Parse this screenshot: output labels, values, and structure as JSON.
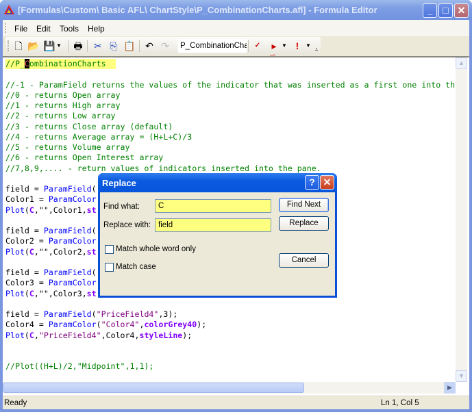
{
  "window": {
    "title": "[Formulas\\Custom\\ Basic AFL\\ ChartStyle\\P_CombinationCharts.afl] - Formula Editor"
  },
  "menu": [
    "File",
    "Edit",
    "Tools",
    "Help"
  ],
  "toolbar": {
    "formula_combo": "P_CombinationChar",
    "icons": [
      "new-file-icon",
      "open-folder-icon",
      "save-icon",
      "dropdown-arrow-icon",
      "print-icon",
      "cut-icon",
      "copy-icon",
      "paste-icon",
      "undo-icon",
      "redo-icon",
      "afl-check-icon",
      "apply-chart-icon",
      "dropdown-arrow-icon",
      "exclamation-icon",
      "dropdown-arrow-icon",
      "toolbar-options-icon"
    ]
  },
  "code": [
    [
      [
        "//P_",
        "c"
      ],
      [
        "C",
        "cur"
      ],
      [
        "ombinationCharts",
        "c"
      ]
    ],
    [],
    [
      [
        "//-1 - ParamField returns the values of the indicator that was inserted as a first one into th",
        "c"
      ]
    ],
    [
      [
        "//0 - returns Open array",
        "c"
      ]
    ],
    [
      [
        "//1 - returns High array",
        "c"
      ]
    ],
    [
      [
        "//2 - returns Low array",
        "c"
      ]
    ],
    [
      [
        "//3 - returns Close array (default)",
        "c"
      ]
    ],
    [
      [
        "//4 - returns Average array = (H+L+C)/3",
        "c"
      ]
    ],
    [
      [
        "//5 - returns Volume array",
        "c"
      ]
    ],
    [
      [
        "//6 - returns Open Interest array",
        "c"
      ]
    ],
    [
      [
        "//7,8,9,.... - return values of indicators inserted into the pane.",
        "c"
      ]
    ],
    [],
    [
      [
        "field = ",
        "n"
      ],
      [
        "ParamField",
        "f"
      ],
      [
        "(",
        "n"
      ]
    ],
    [
      [
        "Color1 = ",
        "n"
      ],
      [
        "ParamColor",
        "f"
      ]
    ],
    [
      [
        "Plot",
        "f"
      ],
      [
        "(",
        "n"
      ],
      [
        "C",
        "k"
      ],
      [
        ",\"\",Color1,",
        "n"
      ],
      [
        "st",
        "k"
      ]
    ],
    [],
    [
      [
        "field = ",
        "n"
      ],
      [
        "ParamField",
        "f"
      ],
      [
        "(",
        "n"
      ]
    ],
    [
      [
        "Color2 = ",
        "n"
      ],
      [
        "ParamColor",
        "f"
      ]
    ],
    [
      [
        "Plot",
        "f"
      ],
      [
        "(",
        "n"
      ],
      [
        "C",
        "k"
      ],
      [
        ",\"\",Color2,",
        "n"
      ],
      [
        "st",
        "k"
      ]
    ],
    [],
    [
      [
        "field = ",
        "n"
      ],
      [
        "ParamField",
        "f"
      ],
      [
        "(",
        "n"
      ]
    ],
    [
      [
        "Color3 = ",
        "n"
      ],
      [
        "ParamColor",
        "f"
      ]
    ],
    [
      [
        "Plot",
        "f"
      ],
      [
        "(",
        "n"
      ],
      [
        "C",
        "k"
      ],
      [
        ",\"\",Color3,",
        "n"
      ],
      [
        "st",
        "k"
      ]
    ],
    [],
    [
      [
        "field = ",
        "n"
      ],
      [
        "ParamField",
        "f"
      ],
      [
        "(",
        "n"
      ],
      [
        "\"PriceField4\"",
        "s"
      ],
      [
        ",3);",
        "n"
      ]
    ],
    [
      [
        "Color4 = ",
        "n"
      ],
      [
        "ParamColor",
        "f"
      ],
      [
        "(",
        "n"
      ],
      [
        "\"Color4\"",
        "s"
      ],
      [
        ",",
        "n"
      ],
      [
        "colorGrey40",
        "k"
      ],
      [
        ");",
        "n"
      ]
    ],
    [
      [
        "Plot",
        "f"
      ],
      [
        "(",
        "n"
      ],
      [
        "C",
        "k"
      ],
      [
        ",",
        "n"
      ],
      [
        "\"PriceField4\"",
        "s"
      ],
      [
        ",Color4,",
        "n"
      ],
      [
        "styleLine",
        "k"
      ],
      [
        ");",
        "n"
      ]
    ],
    [],
    [],
    [
      [
        "//Plot((H+L)/2,\"Midpoint\",1,1);",
        "c"
      ]
    ]
  ],
  "status": {
    "left": "Ready",
    "position": "Ln 1, Col 5"
  },
  "dialog": {
    "title": "Replace",
    "find_label": "Find what:",
    "find_value": "C",
    "replace_label": "Replace with:",
    "replace_value": "field",
    "whole_word_label": "Match whole word only",
    "whole_word_checked": false,
    "match_case_label": "Match case",
    "match_case_checked": false,
    "find_next": "Find Next",
    "replace": "Replace",
    "cancel": "Cancel"
  }
}
